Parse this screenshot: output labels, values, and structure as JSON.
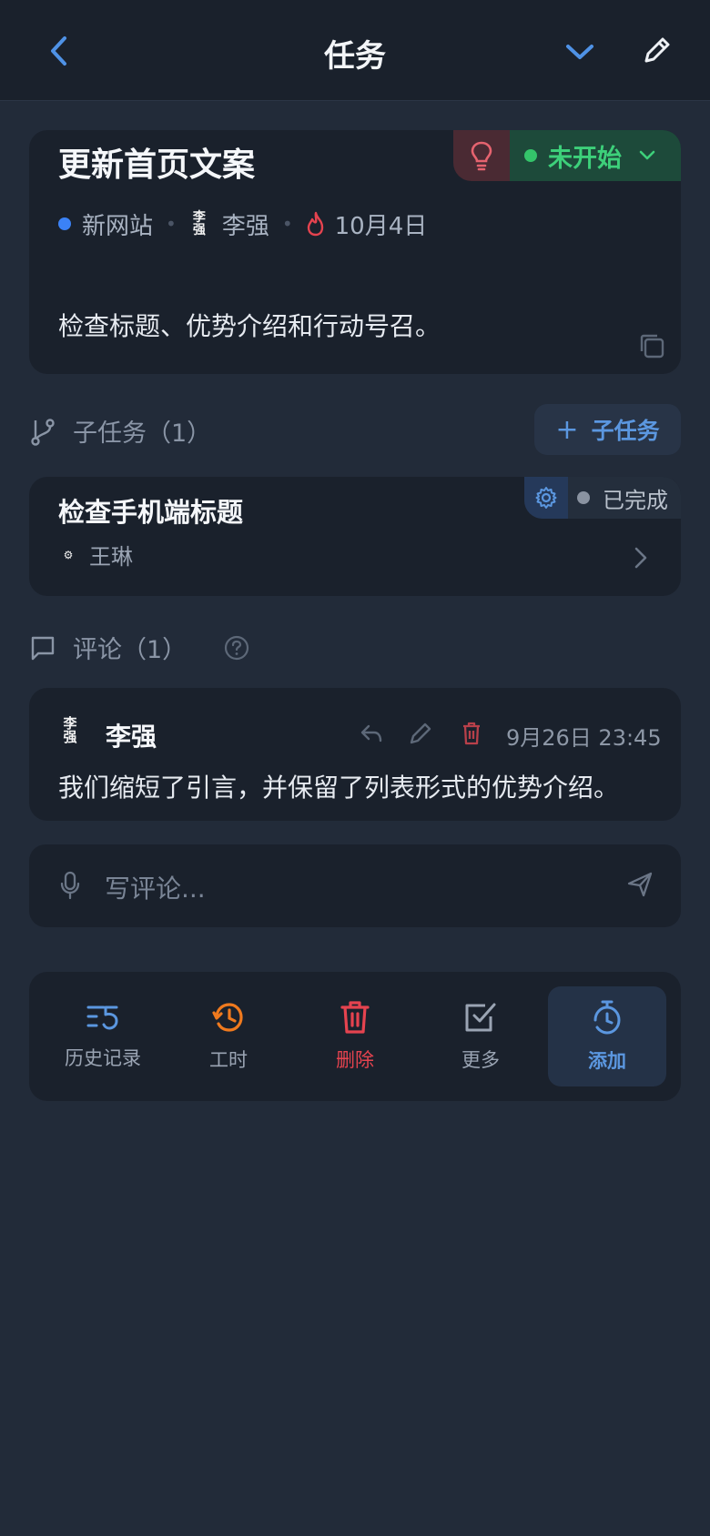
{
  "header": {
    "title": "任务"
  },
  "task": {
    "title": "更新首页文案",
    "status": "未开始",
    "project": "新网站",
    "assignee": "李强",
    "assignee_avatar_text": "李\n强",
    "due_date": "10月4日",
    "description": "检查标题、优势介绍和行动号召。"
  },
  "subtasks": {
    "label": "子任务（1）",
    "add_label": "子任务",
    "items": [
      {
        "title": "检查手机端标题",
        "status": "已完成",
        "assignee": "王琳"
      }
    ]
  },
  "comments": {
    "label": "评论（1）",
    "items": [
      {
        "author": "李强",
        "time": "9月26日 23:45",
        "text": "我们缩短了引言，并保留了列表形式的优势介绍。"
      }
    ]
  },
  "comment_input": {
    "placeholder": "写评论..."
  },
  "actions": [
    {
      "label": "历史记录",
      "icon": "history-list-icon",
      "color": "#5b97e0"
    },
    {
      "label": "工时",
      "icon": "time-history-icon",
      "color": "#f07a1e"
    },
    {
      "label": "删除",
      "icon": "trash-icon",
      "color": "#e5434f"
    },
    {
      "label": "更多",
      "icon": "checkbox-icon",
      "color": "#9aa4b3"
    },
    {
      "label": "添加",
      "icon": "timer-icon",
      "color": "#5b97e0"
    }
  ],
  "colors": {
    "accent": "#5b97e0",
    "status_not_started": "#3dd07a",
    "danger": "#e5434f",
    "warning": "#f07a1e"
  }
}
